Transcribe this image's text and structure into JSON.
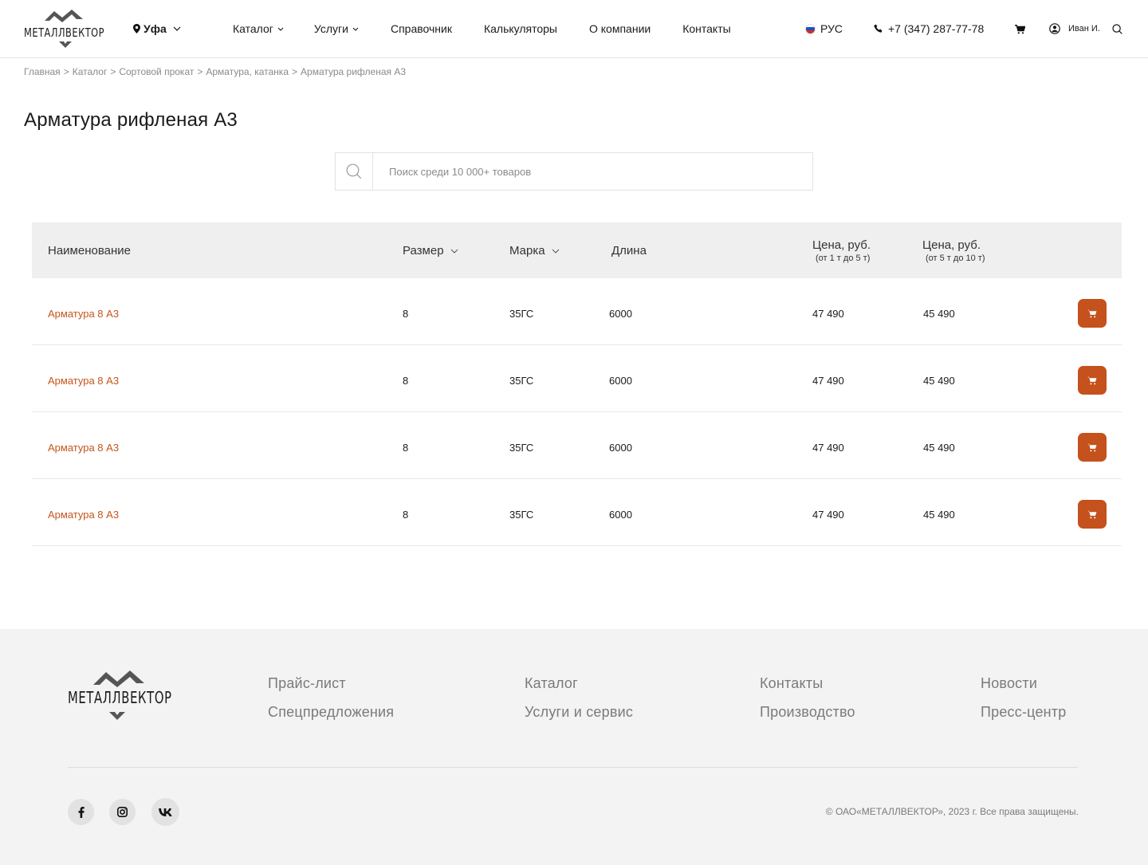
{
  "header": {
    "logo_text": "МЕТАЛЛВЕКТОР",
    "city": "Уфа",
    "nav": [
      {
        "label": "Каталог",
        "dropdown": true
      },
      {
        "label": "Услуги",
        "dropdown": true
      },
      {
        "label": "Справочник",
        "dropdown": false
      },
      {
        "label": "Калькуляторы",
        "dropdown": false
      },
      {
        "label": "О компании",
        "dropdown": false
      },
      {
        "label": "Контакты",
        "dropdown": false
      }
    ],
    "language": "РУС",
    "phone": "+7 (347) 287-77-78",
    "user_name": "Иван И.",
    "icons": [
      "location-pin-icon",
      "chevron-down-icon",
      "flag-ru-icon",
      "phone-icon",
      "cart-icon",
      "user-circle-icon",
      "search-icon"
    ]
  },
  "breadcrumb": [
    "Главная",
    "Каталог",
    "Сортовой прокат",
    "Арматура, катанка",
    "Арматура рифленая А3"
  ],
  "breadcrumb_separator": ">",
  "page_title": "Арматура рифленая А3",
  "search": {
    "placeholder": "Поиск среди 10 000+ товаров",
    "value": ""
  },
  "table": {
    "columns": {
      "name": "Наименование",
      "size": "Размер",
      "grade": "Марка",
      "length": "Длина",
      "price1_title": "Цена, руб.",
      "price1_note": "(от 1 т до 5 т)",
      "price2_title": "Цена, руб.",
      "price2_note": "(от 5 т до 10 т)"
    },
    "rows": [
      {
        "name": "Арматура 8 А3",
        "size": "8",
        "grade": "35ГС",
        "length": "6000",
        "price1": "47 490",
        "price2": "45 490"
      },
      {
        "name": "Арматура 8 А3",
        "size": "8",
        "grade": "35ГС",
        "length": "6000",
        "price1": "47 490",
        "price2": "45 490"
      },
      {
        "name": "Арматура 8 А3",
        "size": "8",
        "grade": "35ГС",
        "length": "6000",
        "price1": "47 490",
        "price2": "45 490"
      },
      {
        "name": "Арматура 8 А3",
        "size": "8",
        "grade": "35ГС",
        "length": "6000",
        "price1": "47 490",
        "price2": "45 490"
      }
    ]
  },
  "footer": {
    "logo_text": "МЕТАЛЛВЕКТОР",
    "links": {
      "price_list": "Прайс-лист",
      "special_offers": "Спецпредложения",
      "catalog": "Каталог",
      "services": "Услуги и сервис",
      "contacts": "Контакты",
      "production": "Производство",
      "news": "Новости",
      "press_center": "Пресс-центр"
    },
    "socials": [
      "facebook-icon",
      "instagram-icon",
      "vk-icon"
    ],
    "copyright": "© ОАО«МЕТАЛЛВЕКТОР», 2023 г. Все права защищены."
  },
  "colors": {
    "accent": "#c5511c",
    "link_orange": "#c4551c",
    "table_header_bg": "#efefef",
    "footer_bg": "#f3f3f3"
  }
}
